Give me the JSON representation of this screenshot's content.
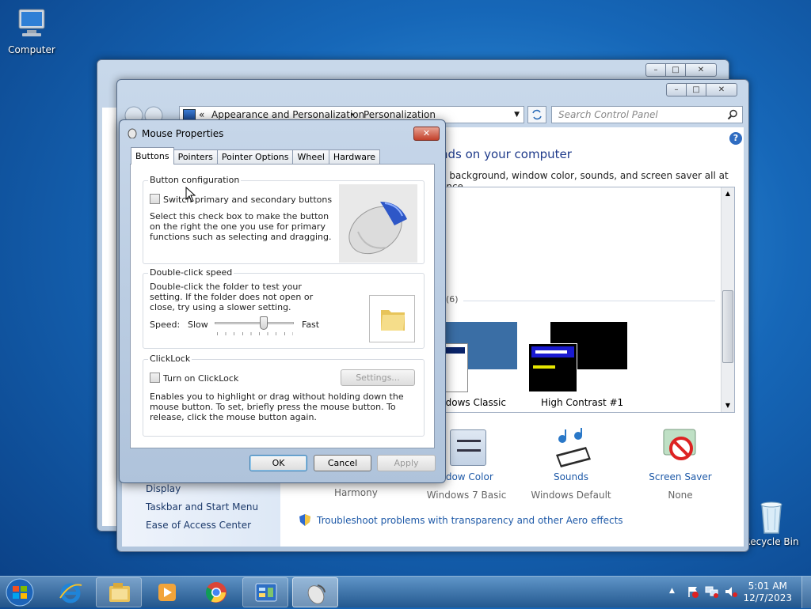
{
  "desktop": {
    "computer_label": "Computer",
    "recycle_label": "Recycle Bin"
  },
  "back_window": {
    "controls": [
      "–",
      "□",
      "✕"
    ]
  },
  "control_panel": {
    "address_chevron": "«",
    "breadcrumb_1": "Appearance and Personalization",
    "breadcrumb_sep": "▸",
    "breadcrumb_2": "Personalization",
    "search_placeholder": "Search Control Panel",
    "heading": "nds on your computer",
    "subtext": "p background, window color, sounds, and screen saver all at once.",
    "group_count": "(6)",
    "theme_windows_classic": "ndows Classic",
    "theme_high_contrast": "High Contrast #1",
    "left_links": [
      "Display",
      "Taskbar and Start Menu",
      "Ease of Access Center"
    ],
    "bottom_items": [
      {
        "title": "ndow Color",
        "value": "Windows 7 Basic"
      },
      {
        "title": "Sounds",
        "value": "Windows Default"
      },
      {
        "title": "Screen Saver",
        "value": "None"
      }
    ],
    "harmony_label": "Harmony",
    "troubleshoot_link": "Troubleshoot problems with transparency and other Aero effects",
    "help_glyph": "?"
  },
  "mouse_dialog": {
    "title": "Mouse Properties",
    "tabs": [
      "Buttons",
      "Pointers",
      "Pointer Options",
      "Wheel",
      "Hardware"
    ],
    "button_config": {
      "label": "Button configuration",
      "checkbox_label": "Switch primary and secondary buttons",
      "description": "Select this check box to make the button on the right the one you use for primary functions such as selecting and dragging."
    },
    "double_click": {
      "label": "Double-click speed",
      "description": "Double-click the folder to test your setting. If the folder does not open or close, try using a slower setting.",
      "speed_label": "Speed:",
      "slow": "Slow",
      "fast": "Fast",
      "speed_value": 0.62
    },
    "clicklock": {
      "label": "ClickLock",
      "checkbox_label": "Turn on ClickLock",
      "settings_button": "Settings...",
      "description": "Enables you to highlight or drag without holding down the mouse button. To set, briefly press the mouse button. To release, click the mouse button again."
    },
    "ok": "OK",
    "cancel": "Cancel",
    "apply": "Apply"
  },
  "taskbar": {
    "time": "5:01 AM",
    "date": "12/7/2023",
    "tray_arrow": "▲"
  },
  "colors": {
    "link_blue": "#1f5aa8",
    "title_blue": "#1e3a8a"
  }
}
